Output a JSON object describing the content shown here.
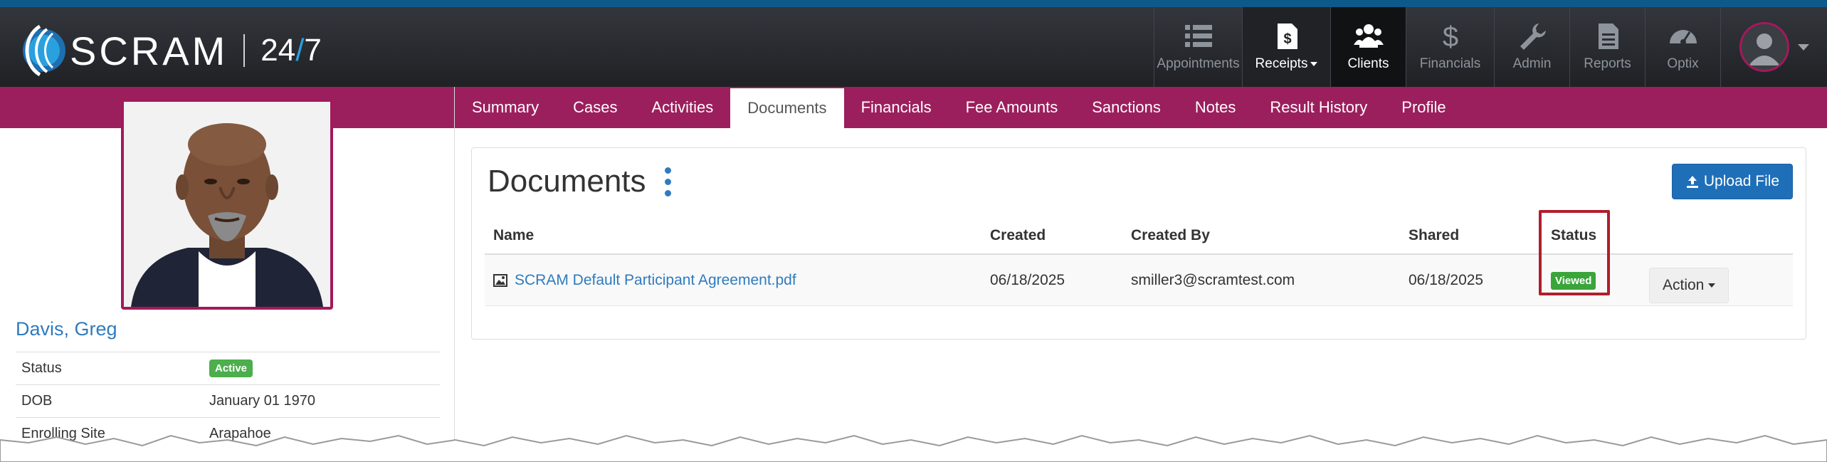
{
  "brand": {
    "name": "SCRAM",
    "suffix_a": "24",
    "suffix_slash": "/",
    "suffix_b": "7"
  },
  "nav": [
    {
      "label": "Appointments",
      "icon": "list-icon"
    },
    {
      "label": "Receipts",
      "icon": "receipt-icon"
    },
    {
      "label": "Clients",
      "icon": "users-icon"
    },
    {
      "label": "Financials",
      "icon": "dollar-icon"
    },
    {
      "label": "Admin",
      "icon": "wrench-icon"
    },
    {
      "label": "Reports",
      "icon": "document-icon"
    },
    {
      "label": "Optix",
      "icon": "dashboard-icon"
    }
  ],
  "client": {
    "name": "Davis, Greg",
    "details": [
      {
        "label": "Status",
        "value": "Active"
      },
      {
        "label": "DOB",
        "value": "January 01 1970"
      },
      {
        "label": "Enrolling Site",
        "value": "Arapahoe"
      }
    ]
  },
  "tabs": [
    "Summary",
    "Cases",
    "Activities",
    "Documents",
    "Financials",
    "Fee Amounts",
    "Sanctions",
    "Notes",
    "Result History",
    "Profile"
  ],
  "documents": {
    "title": "Documents",
    "upload_label": "Upload File",
    "columns": [
      "Name",
      "Created",
      "Created By",
      "Shared",
      "Status"
    ],
    "rows": [
      {
        "name": "SCRAM Default Participant Agreement.pdf",
        "created": "06/18/2025",
        "created_by": "smiller3@scramtest.com",
        "shared": "06/18/2025",
        "status": "Viewed",
        "action": "Action"
      }
    ]
  },
  "colors": {
    "brand_magenta": "#9c1f5d",
    "link_blue": "#2f7bbf",
    "status_green": "#3aa53a",
    "highlight_red": "#b01e2c"
  }
}
